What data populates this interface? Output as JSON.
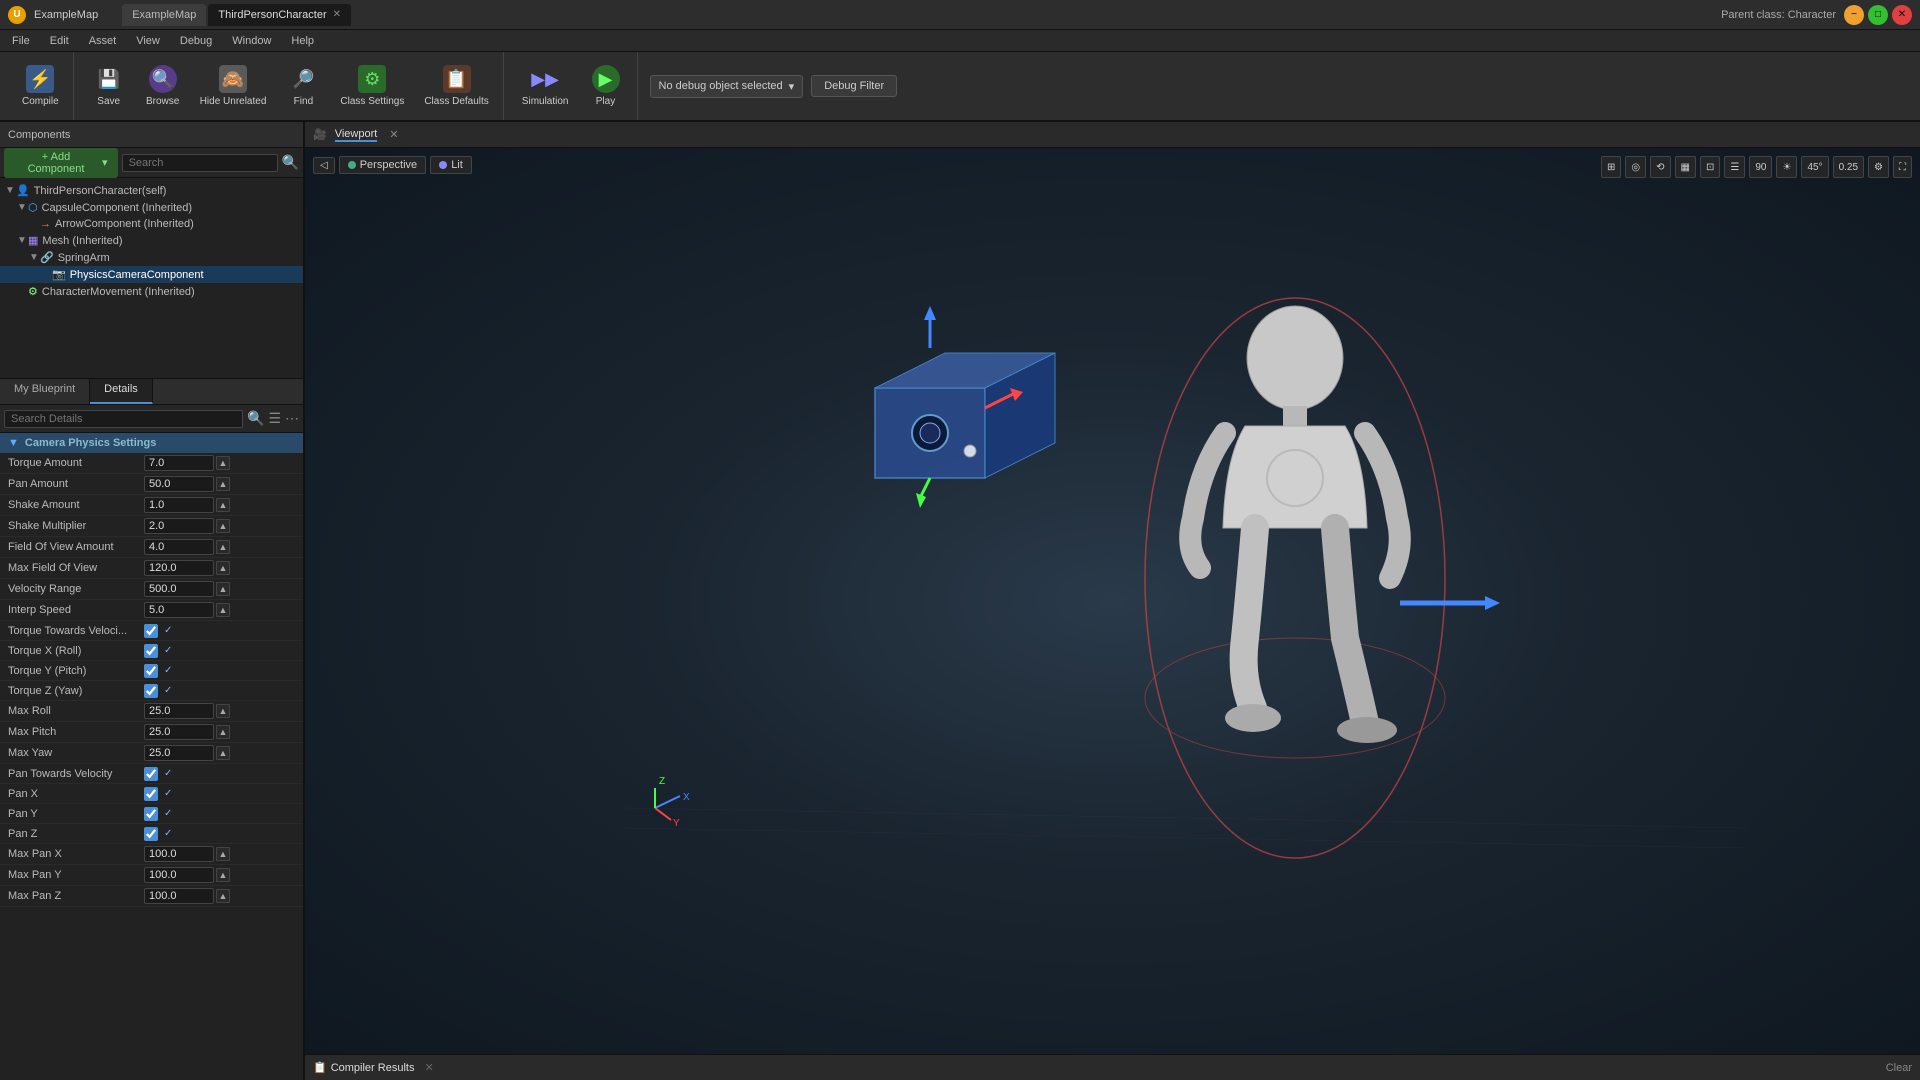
{
  "titleBar": {
    "appName": "U",
    "mapName": "ExampleMap",
    "activeTab": "ThirdPersonCharacter",
    "tabs": [
      {
        "label": "ExampleMap",
        "active": false
      },
      {
        "label": "ThirdPersonCharacter",
        "active": true
      }
    ],
    "parentClass": "Parent class: Character"
  },
  "menuBar": {
    "items": [
      "File",
      "Edit",
      "Asset",
      "View",
      "Debug",
      "Window",
      "Help"
    ]
  },
  "toolbar": {
    "compile_label": "Compile",
    "save_label": "Save",
    "browse_label": "Browse",
    "hide_label": "Hide Unrelated",
    "find_label": "Find",
    "class_settings_label": "Class Settings",
    "class_defaults_label": "Class Defaults",
    "simulation_label": "Simulation",
    "play_label": "Play",
    "debug_dropdown": "No debug object selected",
    "debug_filter": "Debug Filter"
  },
  "components": {
    "header": "Components",
    "add_label": "+ Add Component",
    "search_placeholder": "Search",
    "tree": [
      {
        "label": "ThirdPersonCharacter(self)",
        "indent": 0,
        "expandable": true,
        "expanded": true,
        "icon": "👤"
      },
      {
        "label": "CapsuleComponent (Inherited)",
        "indent": 1,
        "expandable": true,
        "expanded": true,
        "icon": "⬡"
      },
      {
        "label": "ArrowComponent (Inherited)",
        "indent": 2,
        "expandable": false,
        "icon": "→"
      },
      {
        "label": "Mesh (Inherited)",
        "indent": 1,
        "expandable": true,
        "expanded": true,
        "icon": "▦"
      },
      {
        "label": "SpringArm",
        "indent": 2,
        "expandable": true,
        "expanded": true,
        "icon": "🔗"
      },
      {
        "label": "PhysicsCameraComponent",
        "indent": 3,
        "expandable": false,
        "icon": "📷",
        "selected": true
      },
      {
        "label": "CharacterMovement (Inherited)",
        "indent": 1,
        "expandable": false,
        "icon": "⚙"
      }
    ]
  },
  "panels": {
    "myBlueprint": "My Blueprint",
    "details": "Details"
  },
  "detailsSearch": {
    "placeholder": "Search Details"
  },
  "cameraPhysics": {
    "sectionTitle": "Camera Physics Settings",
    "properties": [
      {
        "label": "Torque Amount",
        "value": "7.0",
        "type": "number"
      },
      {
        "label": "Pan Amount",
        "value": "50.0",
        "type": "number"
      },
      {
        "label": "Shake Amount",
        "value": "1.0",
        "type": "number"
      },
      {
        "label": "Shake Multiplier",
        "value": "2.0",
        "type": "number"
      },
      {
        "label": "Field Of View Amount",
        "value": "4.0",
        "type": "number"
      },
      {
        "label": "Max Field Of View",
        "value": "120.0",
        "type": "number"
      },
      {
        "label": "Velocity Range",
        "value": "500.0",
        "type": "number"
      },
      {
        "label": "Interp Speed",
        "value": "5.0",
        "type": "number"
      },
      {
        "label": "Torque Towards Veloci...",
        "value": true,
        "type": "checkbox"
      },
      {
        "label": "Torque X (Roll)",
        "value": true,
        "type": "checkbox"
      },
      {
        "label": "Torque Y (Pitch)",
        "value": true,
        "type": "checkbox"
      },
      {
        "label": "Torque Z (Yaw)",
        "value": true,
        "type": "checkbox"
      },
      {
        "label": "Max Roll",
        "value": "25.0",
        "type": "number"
      },
      {
        "label": "Max Pitch",
        "value": "25.0",
        "type": "number"
      },
      {
        "label": "Max Yaw",
        "value": "25.0",
        "type": "number"
      },
      {
        "label": "Pan Towards Velocity",
        "value": true,
        "type": "checkbox"
      },
      {
        "label": "Pan X",
        "value": true,
        "type": "checkbox"
      },
      {
        "label": "Pan Y",
        "value": true,
        "type": "checkbox"
      },
      {
        "label": "Pan Z",
        "value": true,
        "type": "checkbox"
      },
      {
        "label": "Max Pan X",
        "value": "100.0",
        "type": "number"
      },
      {
        "label": "Max Pan Y",
        "value": "100.0",
        "type": "number"
      },
      {
        "label": "Max Pan Z",
        "value": "100.0",
        "type": "number"
      }
    ]
  },
  "viewport": {
    "header": "Viewport",
    "perspective_label": "Perspective",
    "lit_label": "Lit",
    "fov": "90",
    "angle": "45°",
    "scale": "0.25"
  },
  "compiler": {
    "tab_label": "Compiler Results"
  }
}
